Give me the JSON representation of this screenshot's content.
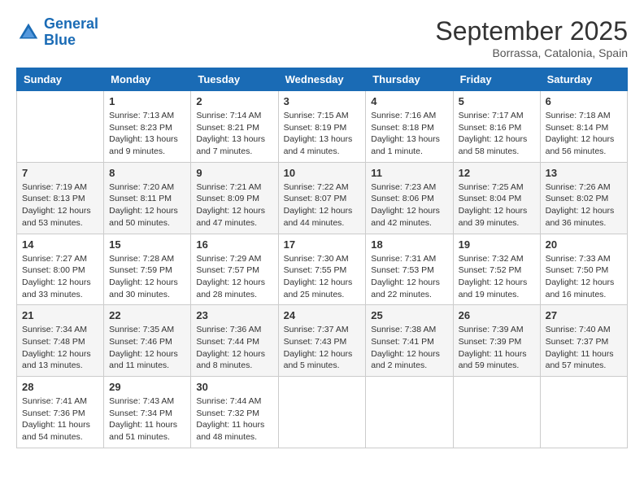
{
  "logo": {
    "line1": "General",
    "line2": "Blue"
  },
  "title": "September 2025",
  "location": "Borrassa, Catalonia, Spain",
  "days_of_week": [
    "Sunday",
    "Monday",
    "Tuesday",
    "Wednesday",
    "Thursday",
    "Friday",
    "Saturday"
  ],
  "weeks": [
    [
      {
        "day": "",
        "info": ""
      },
      {
        "day": "1",
        "info": "Sunrise: 7:13 AM\nSunset: 8:23 PM\nDaylight: 13 hours\nand 9 minutes."
      },
      {
        "day": "2",
        "info": "Sunrise: 7:14 AM\nSunset: 8:21 PM\nDaylight: 13 hours\nand 7 minutes."
      },
      {
        "day": "3",
        "info": "Sunrise: 7:15 AM\nSunset: 8:19 PM\nDaylight: 13 hours\nand 4 minutes."
      },
      {
        "day": "4",
        "info": "Sunrise: 7:16 AM\nSunset: 8:18 PM\nDaylight: 13 hours\nand 1 minute."
      },
      {
        "day": "5",
        "info": "Sunrise: 7:17 AM\nSunset: 8:16 PM\nDaylight: 12 hours\nand 58 minutes."
      },
      {
        "day": "6",
        "info": "Sunrise: 7:18 AM\nSunset: 8:14 PM\nDaylight: 12 hours\nand 56 minutes."
      }
    ],
    [
      {
        "day": "7",
        "info": "Sunrise: 7:19 AM\nSunset: 8:13 PM\nDaylight: 12 hours\nand 53 minutes."
      },
      {
        "day": "8",
        "info": "Sunrise: 7:20 AM\nSunset: 8:11 PM\nDaylight: 12 hours\nand 50 minutes."
      },
      {
        "day": "9",
        "info": "Sunrise: 7:21 AM\nSunset: 8:09 PM\nDaylight: 12 hours\nand 47 minutes."
      },
      {
        "day": "10",
        "info": "Sunrise: 7:22 AM\nSunset: 8:07 PM\nDaylight: 12 hours\nand 44 minutes."
      },
      {
        "day": "11",
        "info": "Sunrise: 7:23 AM\nSunset: 8:06 PM\nDaylight: 12 hours\nand 42 minutes."
      },
      {
        "day": "12",
        "info": "Sunrise: 7:25 AM\nSunset: 8:04 PM\nDaylight: 12 hours\nand 39 minutes."
      },
      {
        "day": "13",
        "info": "Sunrise: 7:26 AM\nSunset: 8:02 PM\nDaylight: 12 hours\nand 36 minutes."
      }
    ],
    [
      {
        "day": "14",
        "info": "Sunrise: 7:27 AM\nSunset: 8:00 PM\nDaylight: 12 hours\nand 33 minutes."
      },
      {
        "day": "15",
        "info": "Sunrise: 7:28 AM\nSunset: 7:59 PM\nDaylight: 12 hours\nand 30 minutes."
      },
      {
        "day": "16",
        "info": "Sunrise: 7:29 AM\nSunset: 7:57 PM\nDaylight: 12 hours\nand 28 minutes."
      },
      {
        "day": "17",
        "info": "Sunrise: 7:30 AM\nSunset: 7:55 PM\nDaylight: 12 hours\nand 25 minutes."
      },
      {
        "day": "18",
        "info": "Sunrise: 7:31 AM\nSunset: 7:53 PM\nDaylight: 12 hours\nand 22 minutes."
      },
      {
        "day": "19",
        "info": "Sunrise: 7:32 AM\nSunset: 7:52 PM\nDaylight: 12 hours\nand 19 minutes."
      },
      {
        "day": "20",
        "info": "Sunrise: 7:33 AM\nSunset: 7:50 PM\nDaylight: 12 hours\nand 16 minutes."
      }
    ],
    [
      {
        "day": "21",
        "info": "Sunrise: 7:34 AM\nSunset: 7:48 PM\nDaylight: 12 hours\nand 13 minutes."
      },
      {
        "day": "22",
        "info": "Sunrise: 7:35 AM\nSunset: 7:46 PM\nDaylight: 12 hours\nand 11 minutes."
      },
      {
        "day": "23",
        "info": "Sunrise: 7:36 AM\nSunset: 7:44 PM\nDaylight: 12 hours\nand 8 minutes."
      },
      {
        "day": "24",
        "info": "Sunrise: 7:37 AM\nSunset: 7:43 PM\nDaylight: 12 hours\nand 5 minutes."
      },
      {
        "day": "25",
        "info": "Sunrise: 7:38 AM\nSunset: 7:41 PM\nDaylight: 12 hours\nand 2 minutes."
      },
      {
        "day": "26",
        "info": "Sunrise: 7:39 AM\nSunset: 7:39 PM\nDaylight: 11 hours\nand 59 minutes."
      },
      {
        "day": "27",
        "info": "Sunrise: 7:40 AM\nSunset: 7:37 PM\nDaylight: 11 hours\nand 57 minutes."
      }
    ],
    [
      {
        "day": "28",
        "info": "Sunrise: 7:41 AM\nSunset: 7:36 PM\nDaylight: 11 hours\nand 54 minutes."
      },
      {
        "day": "29",
        "info": "Sunrise: 7:43 AM\nSunset: 7:34 PM\nDaylight: 11 hours\nand 51 minutes."
      },
      {
        "day": "30",
        "info": "Sunrise: 7:44 AM\nSunset: 7:32 PM\nDaylight: 11 hours\nand 48 minutes."
      },
      {
        "day": "",
        "info": ""
      },
      {
        "day": "",
        "info": ""
      },
      {
        "day": "",
        "info": ""
      },
      {
        "day": "",
        "info": ""
      }
    ]
  ]
}
